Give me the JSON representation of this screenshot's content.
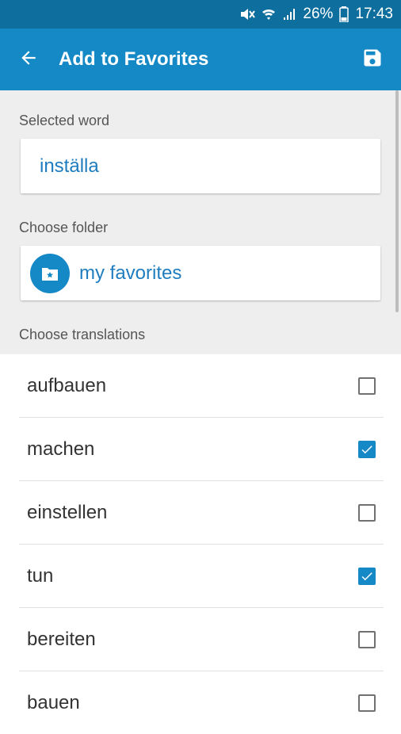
{
  "status_bar": {
    "battery": "26%",
    "time": "17:43",
    "icons": [
      "mute-icon",
      "wifi-icon",
      "signal-icon",
      "battery-icon"
    ]
  },
  "app_bar": {
    "title": "Add to Favorites",
    "back_icon": "arrow-back-icon",
    "save_icon": "save-icon"
  },
  "selected_word": {
    "label": "Selected word",
    "value": "inställa"
  },
  "folder": {
    "label": "Choose folder",
    "value": "my favorites",
    "icon": "folder-star-icon"
  },
  "translations": {
    "label": "Choose translations",
    "items": [
      {
        "text": "aufbauen",
        "checked": false
      },
      {
        "text": "machen",
        "checked": true
      },
      {
        "text": "einstellen",
        "checked": false
      },
      {
        "text": "tun",
        "checked": true
      },
      {
        "text": "bereiten",
        "checked": false
      },
      {
        "text": "bauen",
        "checked": false
      }
    ]
  },
  "colors": {
    "status_bar": "#0e6f9e",
    "app_bar": "#1589c6",
    "accent_text": "#1f7dbf"
  }
}
